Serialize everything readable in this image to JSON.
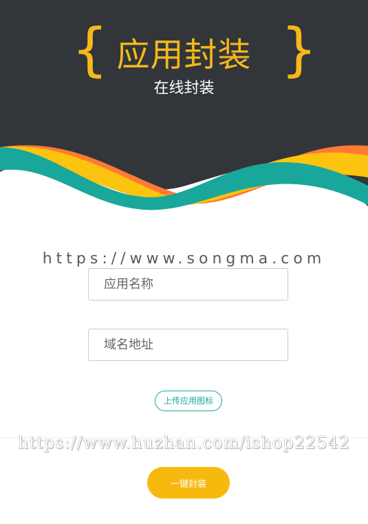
{
  "header": {
    "brace_left": "{",
    "brace_right": "}",
    "title": "应用封装",
    "subtitle": "在线封装"
  },
  "watermarks": {
    "top": "https://www.songma.com",
    "bottom": "https://www.huzhan.com/ishop22542"
  },
  "form": {
    "app_name_placeholder": "应用名称",
    "domain_placeholder": "域名地址",
    "upload_label": "上传应用图标",
    "submit_label": "一键封装"
  },
  "colors": {
    "header_bg": "#32363a",
    "accent_yellow": "#f6b91a",
    "wave_orange": "#ff7a35",
    "wave_yellow": "#fcc40e",
    "wave_teal": "#19a79b",
    "button_yellow": "#f8b90f"
  }
}
